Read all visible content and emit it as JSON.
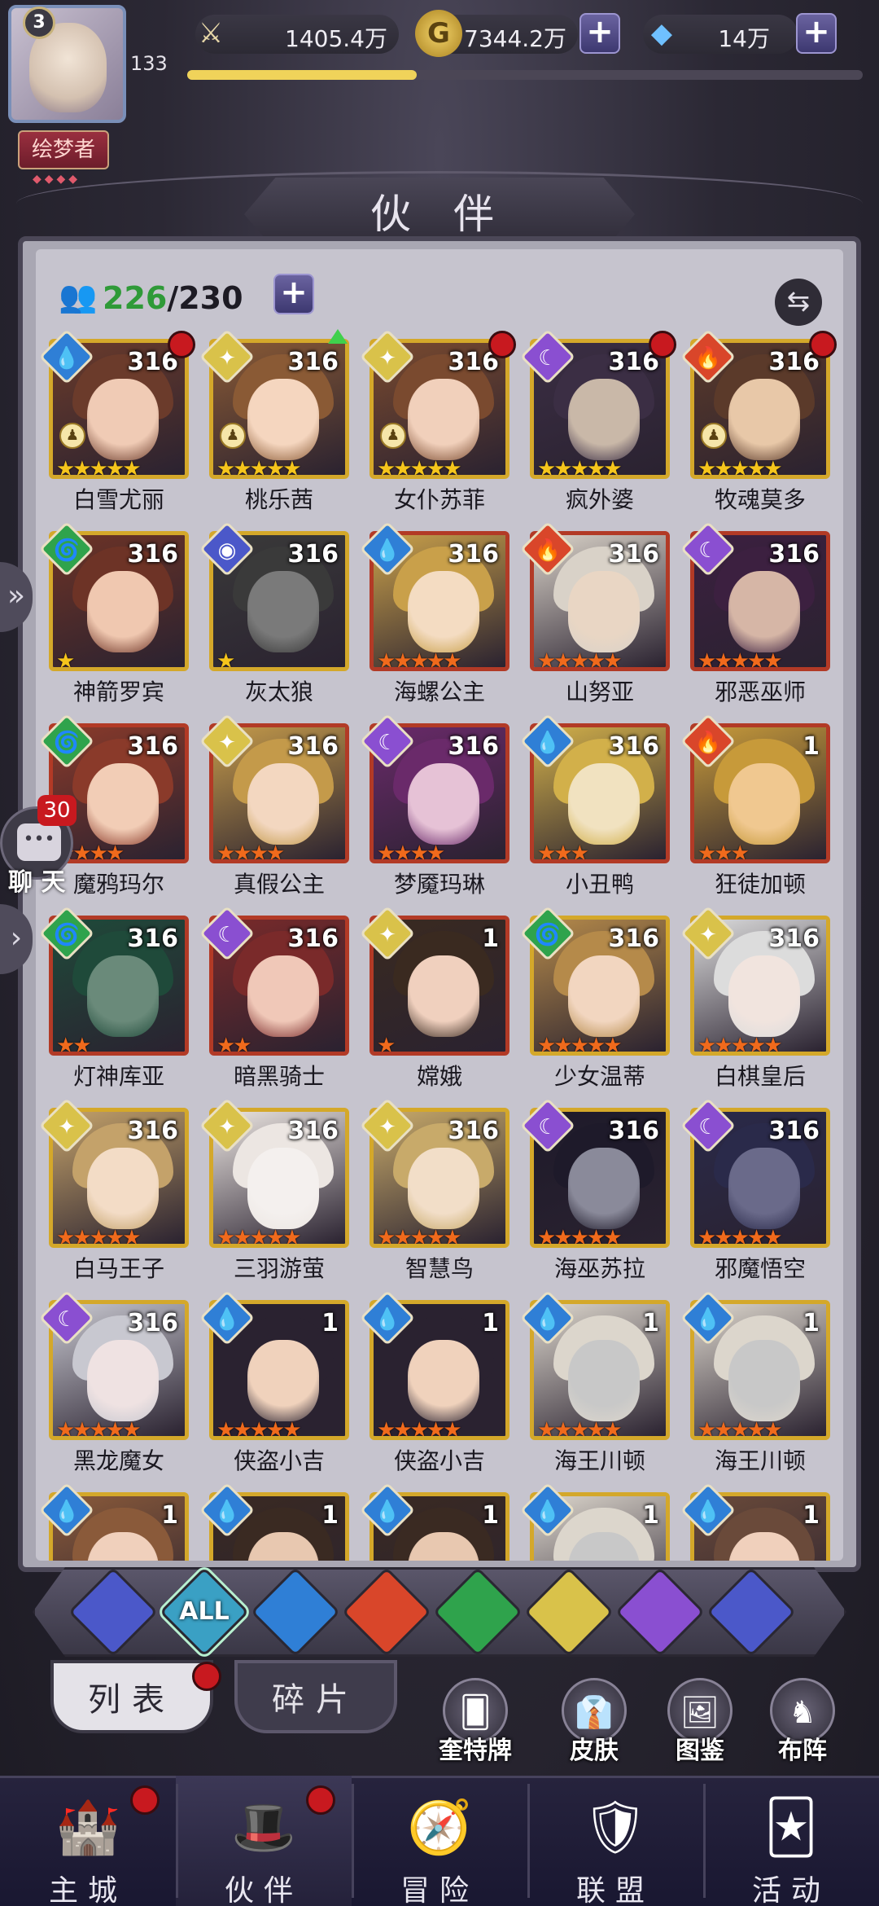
{
  "player": {
    "level": "3",
    "vip_level": "133",
    "title": "绘梦者",
    "exp_progress": 0.34
  },
  "resources": {
    "power": "1405.4万",
    "gold": "7344.2万",
    "diamonds": "14万"
  },
  "header": {
    "title": "伙 伴"
  },
  "roster": {
    "current": "226",
    "capacity": "/230"
  },
  "heroes": [
    {
      "name": "白雪尤丽",
      "level": "316",
      "element": "water",
      "stars": "★★★★★",
      "star_color": "y",
      "frame": "gold",
      "red_dot": true,
      "rank_icon": true
    },
    {
      "name": "桃乐茜",
      "level": "316",
      "element": "light",
      "stars": "★★★★★",
      "star_color": "y",
      "frame": "gold",
      "green_arrow": true,
      "rank_icon": true
    },
    {
      "name": "女仆苏菲",
      "level": "316",
      "element": "light",
      "stars": "★★★★★",
      "star_color": "y",
      "frame": "gold",
      "red_dot": true,
      "rank_icon": true
    },
    {
      "name": "疯外婆",
      "level": "316",
      "element": "dark",
      "stars": "★★★★★",
      "star_color": "y",
      "frame": "gold",
      "red_dot": true
    },
    {
      "name": "牧魂莫多",
      "level": "316",
      "element": "fire",
      "stars": "★★★★★",
      "star_color": "y",
      "frame": "gold",
      "red_dot": true,
      "rank_icon": true
    },
    {
      "name": "神箭罗宾",
      "level": "316",
      "element": "wind",
      "stars": "★",
      "star_color": "y",
      "frame": "gold"
    },
    {
      "name": "灰太狼",
      "level": "316",
      "element": "cosmic",
      "stars": "★",
      "star_color": "y",
      "frame": "gold"
    },
    {
      "name": "海螺公主",
      "level": "316",
      "element": "water",
      "stars": "★★★★★",
      "star_color": "o",
      "frame": "red"
    },
    {
      "name": "山努亚",
      "level": "316",
      "element": "fire",
      "stars": "★★★★★",
      "star_color": "o",
      "frame": "red"
    },
    {
      "name": "邪恶巫师",
      "level": "316",
      "element": "dark",
      "stars": "★★★★★",
      "star_color": "o",
      "frame": "red"
    },
    {
      "name": "魔鸦玛尔",
      "level": "316",
      "element": "wind",
      "stars": "★★★★",
      "star_color": "o",
      "frame": "red"
    },
    {
      "name": "真假公主",
      "level": "316",
      "element": "light",
      "stars": "★★★★",
      "star_color": "o",
      "frame": "red"
    },
    {
      "name": "梦魇玛琳",
      "level": "316",
      "element": "dark",
      "stars": "★★★★",
      "star_color": "o",
      "frame": "red"
    },
    {
      "name": "小丑鸭",
      "level": "316",
      "element": "water",
      "stars": "★★★",
      "star_color": "o",
      "frame": "red"
    },
    {
      "name": "狂徒加顿",
      "level": "1",
      "element": "fire",
      "stars": "★★★",
      "star_color": "o",
      "frame": "red"
    },
    {
      "name": "灯神库亚",
      "level": "316",
      "element": "wind",
      "stars": "★★",
      "star_color": "o",
      "frame": "red"
    },
    {
      "name": "暗黑骑士",
      "level": "316",
      "element": "dark",
      "stars": "★★",
      "star_color": "o",
      "frame": "red"
    },
    {
      "name": "嫦娥",
      "level": "1",
      "element": "light",
      "stars": "★",
      "star_color": "o",
      "frame": "red"
    },
    {
      "name": "少女温蒂",
      "level": "316",
      "element": "wind",
      "stars": "★★★★★",
      "star_color": "o",
      "frame": "gold"
    },
    {
      "name": "白棋皇后",
      "level": "316",
      "element": "light",
      "stars": "★★★★★",
      "star_color": "o",
      "frame": "gold"
    },
    {
      "name": "白马王子",
      "level": "316",
      "element": "light",
      "stars": "★★★★★",
      "star_color": "o",
      "frame": "gold"
    },
    {
      "name": "三羽游萤",
      "level": "316",
      "element": "light",
      "stars": "★★★★★",
      "star_color": "o",
      "frame": "gold"
    },
    {
      "name": "智慧鸟",
      "level": "316",
      "element": "light",
      "stars": "★★★★★",
      "star_color": "o",
      "frame": "gold"
    },
    {
      "name": "海巫苏拉",
      "level": "316",
      "element": "dark",
      "stars": "★★★★★",
      "star_color": "o",
      "frame": "gold"
    },
    {
      "name": "邪魔悟空",
      "level": "316",
      "element": "dark",
      "stars": "★★★★★",
      "star_color": "o",
      "frame": "gold"
    },
    {
      "name": "黑龙魔女",
      "level": "316",
      "element": "dark",
      "stars": "★★★★★",
      "star_color": "o",
      "frame": "gold"
    },
    {
      "name": "侠盗小吉",
      "level": "1",
      "element": "water",
      "stars": "★★★★★",
      "star_color": "o",
      "frame": "gold"
    },
    {
      "name": "侠盗小吉",
      "level": "1",
      "element": "water",
      "stars": "★★★★★",
      "star_color": "o",
      "frame": "gold"
    },
    {
      "name": "海王川顿",
      "level": "1",
      "element": "water",
      "stars": "★★★★★",
      "star_color": "o",
      "frame": "gold"
    },
    {
      "name": "海王川顿",
      "level": "1",
      "element": "water",
      "stars": "★★★★★",
      "star_color": "o",
      "frame": "gold"
    },
    {
      "name": "",
      "level": "1",
      "element": "water",
      "stars": "",
      "star_color": "o",
      "frame": "gold"
    },
    {
      "name": "",
      "level": "1",
      "element": "water",
      "stars": "",
      "star_color": "o",
      "frame": "gold"
    },
    {
      "name": "",
      "level": "1",
      "element": "water",
      "stars": "",
      "star_color": "o",
      "frame": "gold"
    },
    {
      "name": "",
      "level": "1",
      "element": "water",
      "stars": "",
      "star_color": "o",
      "frame": "gold"
    },
    {
      "name": "",
      "level": "1",
      "element": "water",
      "stars": "",
      "star_color": "o",
      "frame": "gold"
    }
  ],
  "chat": {
    "label": "聊 天",
    "count": "30"
  },
  "element_filters": [
    {
      "id": "all-faction",
      "label": ""
    },
    {
      "id": "all",
      "label": "ALL"
    },
    {
      "id": "water",
      "label": ""
    },
    {
      "id": "fire",
      "label": ""
    },
    {
      "id": "wind",
      "label": ""
    },
    {
      "id": "light",
      "label": ""
    },
    {
      "id": "dark",
      "label": ""
    },
    {
      "id": "cosmic",
      "label": ""
    }
  ],
  "sub_tabs": {
    "list": "列表",
    "fragments": "碎片"
  },
  "shortcuts": [
    {
      "label": "奎特牌",
      "icon": "card-deck-icon"
    },
    {
      "label": "皮肤",
      "icon": "outfit-icon"
    },
    {
      "label": "图鉴",
      "icon": "codex-icon"
    },
    {
      "label": "布阵",
      "icon": "chess-formation-icon"
    }
  ],
  "bottom_nav": [
    {
      "label": "主城",
      "icon": "castle-icon",
      "dot": true
    },
    {
      "label": "伙伴",
      "icon": "wizard-hat-icon",
      "dot": true,
      "active": true
    },
    {
      "label": "冒险",
      "icon": "compass-icon"
    },
    {
      "label": "联盟",
      "icon": "shield-icon"
    },
    {
      "label": "活动",
      "icon": "cards-icon"
    }
  ],
  "colors": {
    "water": "#2f7fd6",
    "light": "#d9c24a",
    "dark": "#8a4fd1",
    "fire": "#d9462a",
    "wind": "#2fa34c",
    "cosmic": "#4b58c9",
    "all": "#3aa0c4"
  }
}
